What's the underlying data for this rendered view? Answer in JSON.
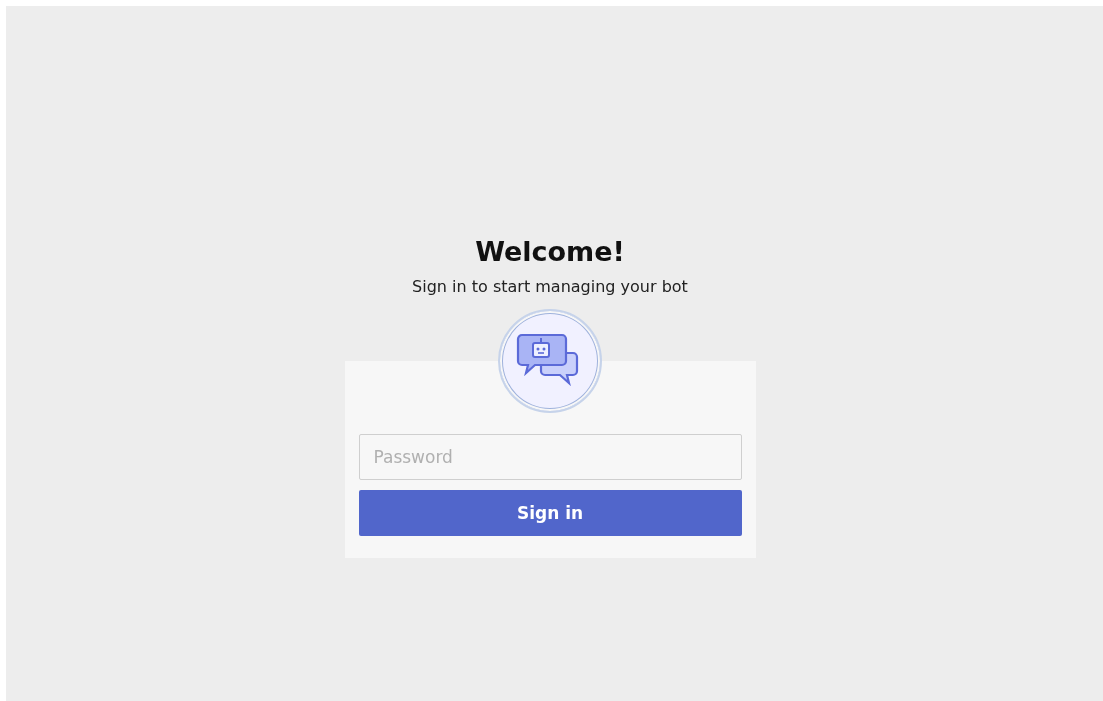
{
  "title": "Welcome!",
  "subtitle": "Sign in to start managing your bot",
  "password": {
    "placeholder": "Password"
  },
  "button": "Sign in"
}
